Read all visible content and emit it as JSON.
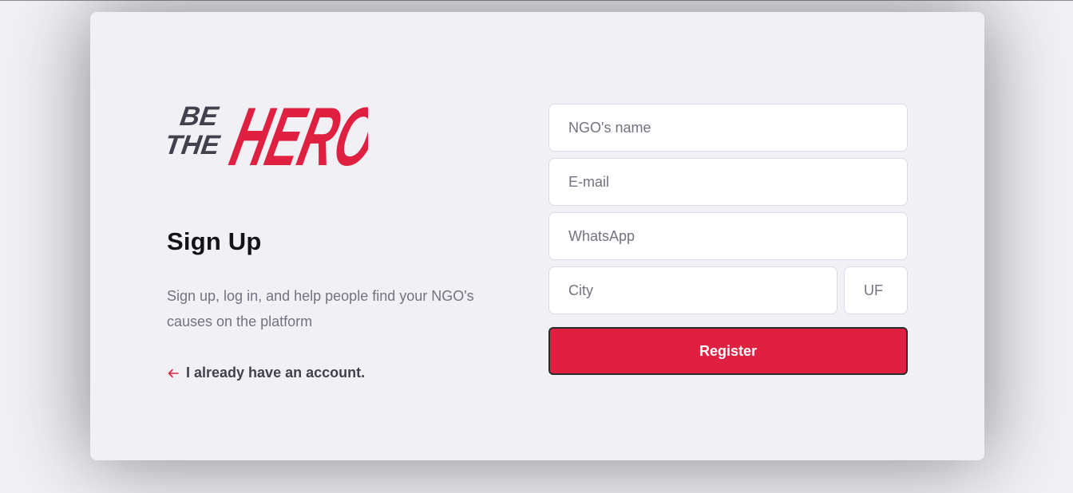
{
  "logo": {
    "alt": "Be The Hero",
    "colors": {
      "dark": "#41414d",
      "brand": "#e02041"
    }
  },
  "intro": {
    "title": "Sign Up",
    "description": "Sign up, log in, and help people find your NGO's causes on the platform",
    "back_link": "I already have an account.",
    "back_icon": "arrow-left-icon"
  },
  "form": {
    "name_placeholder": "NGO's name",
    "email_placeholder": "E-mail",
    "whatsapp_placeholder": "WhatsApp",
    "city_placeholder": "City",
    "uf_placeholder": "UF",
    "submit_label": "Register"
  },
  "colors": {
    "background": "#f0f0f5",
    "accent": "#e02041",
    "text": "#13131a",
    "muted": "#737380",
    "input_border": "#dcdce6"
  }
}
